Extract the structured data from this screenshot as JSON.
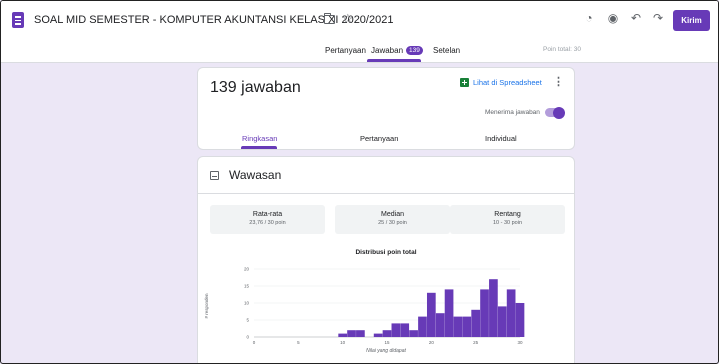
{
  "header": {
    "doc_title": "SOAL MID SEMESTER - KOMPUTER AKUNTANSI KELAS XI 2020/2021",
    "send_label": "Kirim",
    "points_total": "Poin total: 30"
  },
  "tabs": [
    {
      "label": "Pertanyaan"
    },
    {
      "label": "Jawaban",
      "badge": "139"
    },
    {
      "label": "Setelan"
    }
  ],
  "responses": {
    "count_label": "139 jawaban",
    "sheets_link": "Lihat di Spreadsheet",
    "accepting_label": "Menerima jawaban",
    "accepting": true,
    "subtabs": [
      "Ringkasan",
      "Pertanyaan",
      "Individual"
    ]
  },
  "insights": {
    "title": "Wawasan",
    "stats": [
      {
        "label": "Rata-rata",
        "value": "23,76 / 30 poin"
      },
      {
        "label": "Median",
        "value": "25 / 30 poin"
      },
      {
        "label": "Rentang",
        "value": "10 - 30 poin"
      }
    ]
  },
  "colors": {
    "accent": "#673ab7",
    "background": "#ece7f6",
    "bar": "#673ab7",
    "sheets_green": "#188038",
    "link_blue": "#1a73e8"
  },
  "icons": [
    "forms-app-icon",
    "folder-icon",
    "star-icon",
    "palette-icon",
    "eye-icon",
    "undo-icon",
    "redo-icon",
    "sheets-icon",
    "more-vert-icon",
    "insights-icon"
  ],
  "chart_data": {
    "type": "bar",
    "title": "Distribusi poin total",
    "xlabel": "Nilai yang didapat",
    "ylabel": "# responden",
    "x": [
      10,
      11,
      12,
      13,
      14,
      15,
      16,
      17,
      18,
      19,
      20,
      21,
      22,
      23,
      24,
      25,
      26,
      27,
      28,
      29,
      30
    ],
    "values": [
      1,
      2,
      2,
      0,
      1,
      2,
      4,
      4,
      2,
      6,
      5,
      13,
      7,
      14,
      6,
      6,
      8,
      14,
      17,
      9,
      14,
      10
    ],
    "x_values": [
      10,
      11,
      12,
      13,
      14,
      15,
      16,
      17,
      18,
      19,
      20,
      21,
      22,
      23,
      24,
      25,
      26,
      27,
      28,
      29,
      30
    ],
    "y_values": [
      1,
      2,
      2,
      0,
      1,
      2,
      4,
      4,
      2,
      6,
      13,
      7,
      14,
      6,
      6,
      8,
      14,
      17,
      9,
      14,
      10
    ],
    "xlim": [
      0,
      30
    ],
    "ylim": [
      0,
      20
    ],
    "x_ticks": [
      "0",
      "5",
      "10",
      "15",
      "20",
      "25",
      "30"
    ],
    "y_ticks": [
      "0",
      "5",
      "10",
      "15",
      "20"
    ],
    "grid": true
  }
}
